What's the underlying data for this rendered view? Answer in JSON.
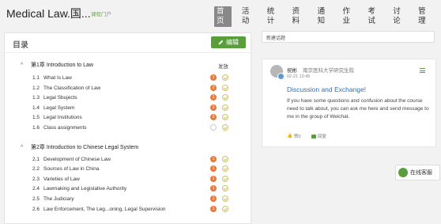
{
  "header": {
    "course_title": "Medical Law.国...",
    "portal_label": "课程门户",
    "nav": [
      "首页",
      "活动",
      "统计",
      "资料",
      "通知",
      "作业",
      "考试",
      "讨论",
      "管理"
    ]
  },
  "catalog": {
    "title": "目录",
    "edit_label": "编辑",
    "publish_label": "发放",
    "chapters": [
      {
        "label": "第1章 Introduction to Law",
        "lessons": [
          {
            "num": "1.1",
            "name": "What Is Law",
            "badge": "1"
          },
          {
            "num": "1.2",
            "name": "The Classification of Law",
            "badge": "2"
          },
          {
            "num": "1.3",
            "name": "Legal Sbujects",
            "badge": "1"
          },
          {
            "num": "1.4",
            "name": "Legal System",
            "badge": "1"
          },
          {
            "num": "1.5",
            "name": "Legal Institutions",
            "badge": "2"
          },
          {
            "num": "1.6",
            "name": "Class assignments",
            "badge": ""
          }
        ]
      },
      {
        "label": "第2章 Introduction to Chinese Legal System",
        "lessons": [
          {
            "num": "2.1",
            "name": "Development of Chinese Law",
            "badge": "1"
          },
          {
            "num": "2.2",
            "name": "Sources of Law in China",
            "badge": "1"
          },
          {
            "num": "2.3",
            "name": "Varieties of Law",
            "badge": "1"
          },
          {
            "num": "2.4",
            "name": "Lawmaking and Legislative Authority",
            "badge": "1"
          },
          {
            "num": "2.5",
            "name": "The Judiciary",
            "badge": "1"
          },
          {
            "num": "2.6",
            "name": "Law Enforcement, The Leg...oning, Legal Supervision",
            "badge": "1"
          }
        ]
      }
    ]
  },
  "discussion": {
    "new_topic_placeholder": "新建话题",
    "author": "祝彬",
    "school": "南京医科大学研究生院",
    "time": "02-21 13:45",
    "title": "Discussion and Exchange!",
    "body": "If you have some questions and confusion about the course need to talk about, you can ask me here and send message to me in the group of Weichat.",
    "likes": "赞0",
    "reply": "回复"
  },
  "service": {
    "label": "在线客服"
  },
  "colors": {
    "accent": "#5a9e3c",
    "badge": "#e8793a",
    "link": "#2f6db6"
  }
}
